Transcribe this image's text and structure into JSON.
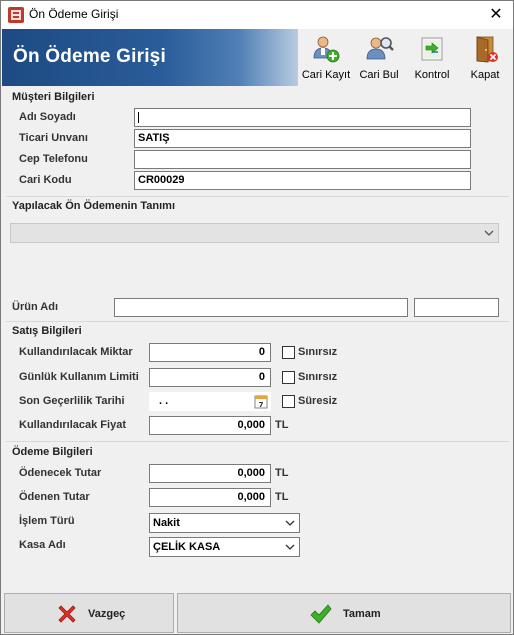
{
  "window": {
    "title": "Ön Ödeme Girişi",
    "close_glyph": "✕"
  },
  "header": {
    "heading": "Ön Ödeme Girişi"
  },
  "toolbar": {
    "cari_kayit": "Cari Kayıt",
    "cari_bul": "Cari Bul",
    "kontrol": "Kontrol",
    "kapat": "Kapat"
  },
  "musteri": {
    "section": "Müşteri Bilgileri",
    "adi_soyadi_label": "Adı Soyadı",
    "adi_soyadi_value": "",
    "ticari_unvani_label": "Ticari Unvanı",
    "ticari_unvani_value": "SATIŞ",
    "cep_telefonu_label": "Cep Telefonu",
    "cep_telefonu_value": "",
    "cari_kodu_label": "Cari Kodu",
    "cari_kodu_value": "CR00029"
  },
  "tanim": {
    "section": "Yapılacak Ön Ödemenin Tanımı",
    "selected": "",
    "urun_adi_label": "Ürün Adı",
    "urun_adi_value": "",
    "urun_kodu_value": ""
  },
  "satis": {
    "section": "Satış Bilgileri",
    "miktar_label": "Kullandırılacak Miktar",
    "miktar_value": "0",
    "sinirsiz_label": "Sınırsız",
    "limit_label": "Günlük Kullanım Limiti",
    "limit_value": "0",
    "sinirsiz2_label": "Sınırsız",
    "tarih_label": "Son Geçerlilik Tarihi",
    "tarih_value": ". .",
    "suresiz_label": "Süresiz",
    "fiyat_label": "Kullandırılacak Fiyat",
    "fiyat_value": "0,000",
    "fiyat_unit": "TL"
  },
  "odeme": {
    "section": "Ödeme Bilgileri",
    "odenecek_label": "Ödenecek Tutar",
    "odenecek_value": "0,000",
    "odenecek_unit": "TL",
    "odenen_label": "Ödenen Tutar",
    "odenen_value": "0,000",
    "odenen_unit": "TL",
    "islem_label": "İşlem Türü",
    "islem_value": "Nakit",
    "kasa_label": "Kasa Adı",
    "kasa_value": "ÇELİK KASA"
  },
  "footer": {
    "vazgec": "Vazgeç",
    "tamam": "Tamam"
  },
  "colors": {
    "banner_start": "#1d4a82",
    "banner_end": "#b9cbe0",
    "cancel_red": "#e0302a",
    "ok_green": "#3fae2a"
  },
  "icons": {
    "app": "app-icon",
    "cari_kayit": "user-add-icon",
    "cari_bul": "user-search-icon",
    "kontrol": "transfer-icon",
    "kapat": "exit-door-icon",
    "calendar": "calendar-icon",
    "vazgec": "cancel-x-icon",
    "tamam": "checkmark-icon"
  }
}
